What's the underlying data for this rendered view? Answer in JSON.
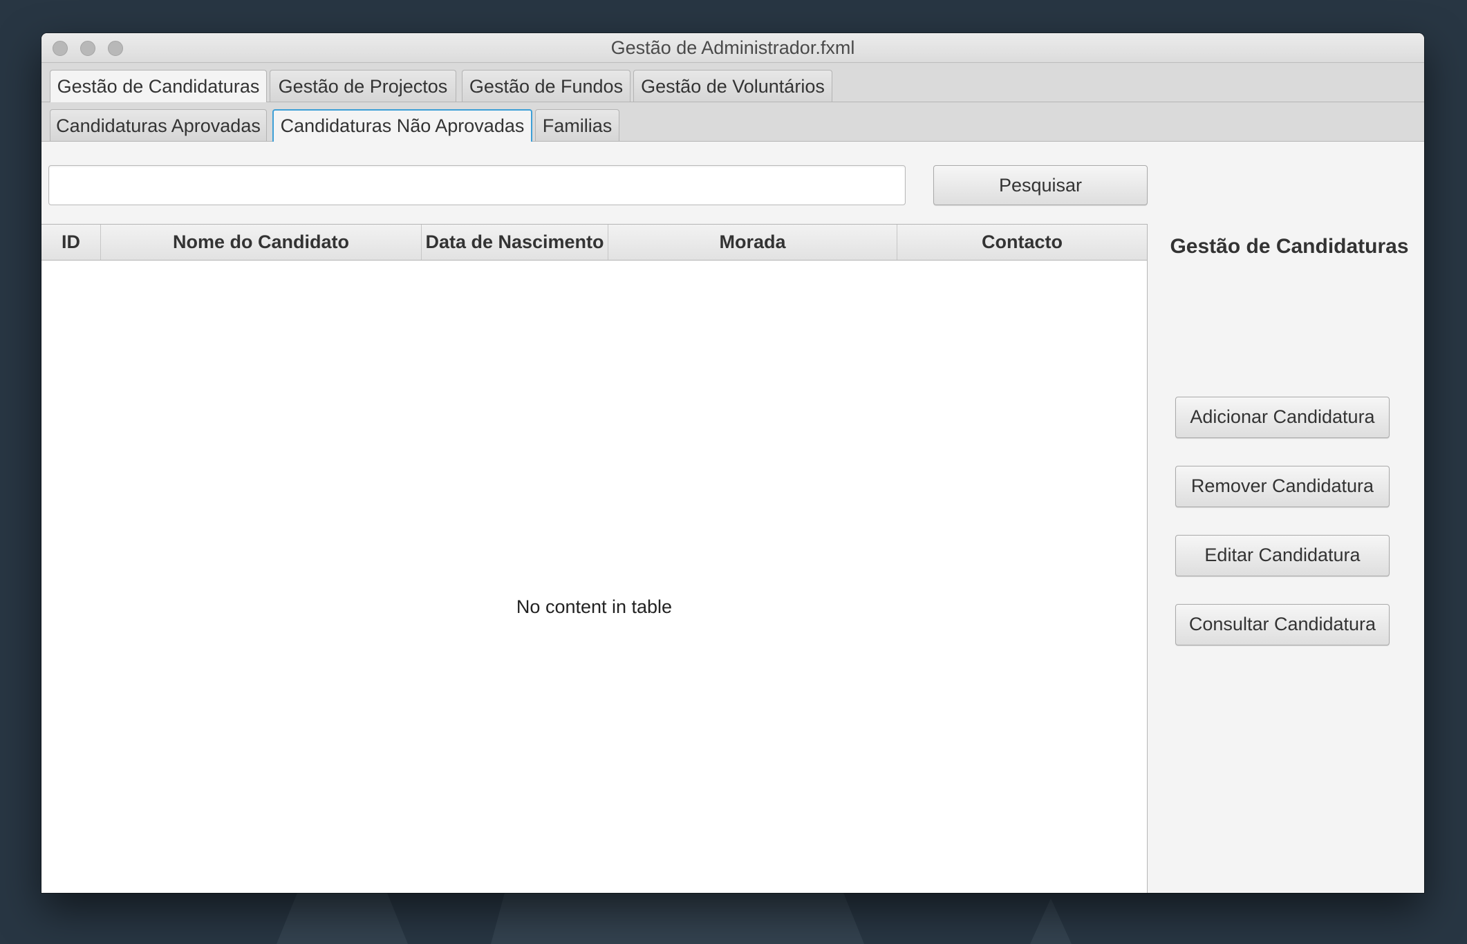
{
  "window": {
    "title": "Gestão de Administrador.fxml"
  },
  "main_tabs": [
    {
      "label": "Gestão de Candidaturas",
      "selected": true
    },
    {
      "label": "Gestão de Projectos",
      "selected": false
    },
    {
      "label": "Gestão de Fundos",
      "selected": false
    },
    {
      "label": "Gestão de Voluntários",
      "selected": false
    }
  ],
  "sub_tabs": [
    {
      "label": "Candidaturas Aprovadas",
      "selected": false
    },
    {
      "label": "Candidaturas Não Aprovadas",
      "selected": true
    },
    {
      "label": "Familias",
      "selected": false
    }
  ],
  "search": {
    "value": "",
    "placeholder": "",
    "button_label": "Pesquisar"
  },
  "table": {
    "columns": [
      "ID",
      "Nome do Candidato",
      "Data de Nascimento",
      "Morada",
      "Contacto"
    ],
    "rows": [],
    "empty_message": "No content in table"
  },
  "side_panel": {
    "title": "Gestão de Candidaturas",
    "buttons": [
      {
        "label": "Adicionar Candidatura"
      },
      {
        "label": "Remover Candidatura"
      },
      {
        "label": "Editar Candidatura"
      },
      {
        "label": "Consultar Candidatura"
      }
    ]
  },
  "colors": {
    "desktop_background": "#283643",
    "window_background": "#f4f4f4",
    "focus_accent": "#3d9fd6"
  }
}
